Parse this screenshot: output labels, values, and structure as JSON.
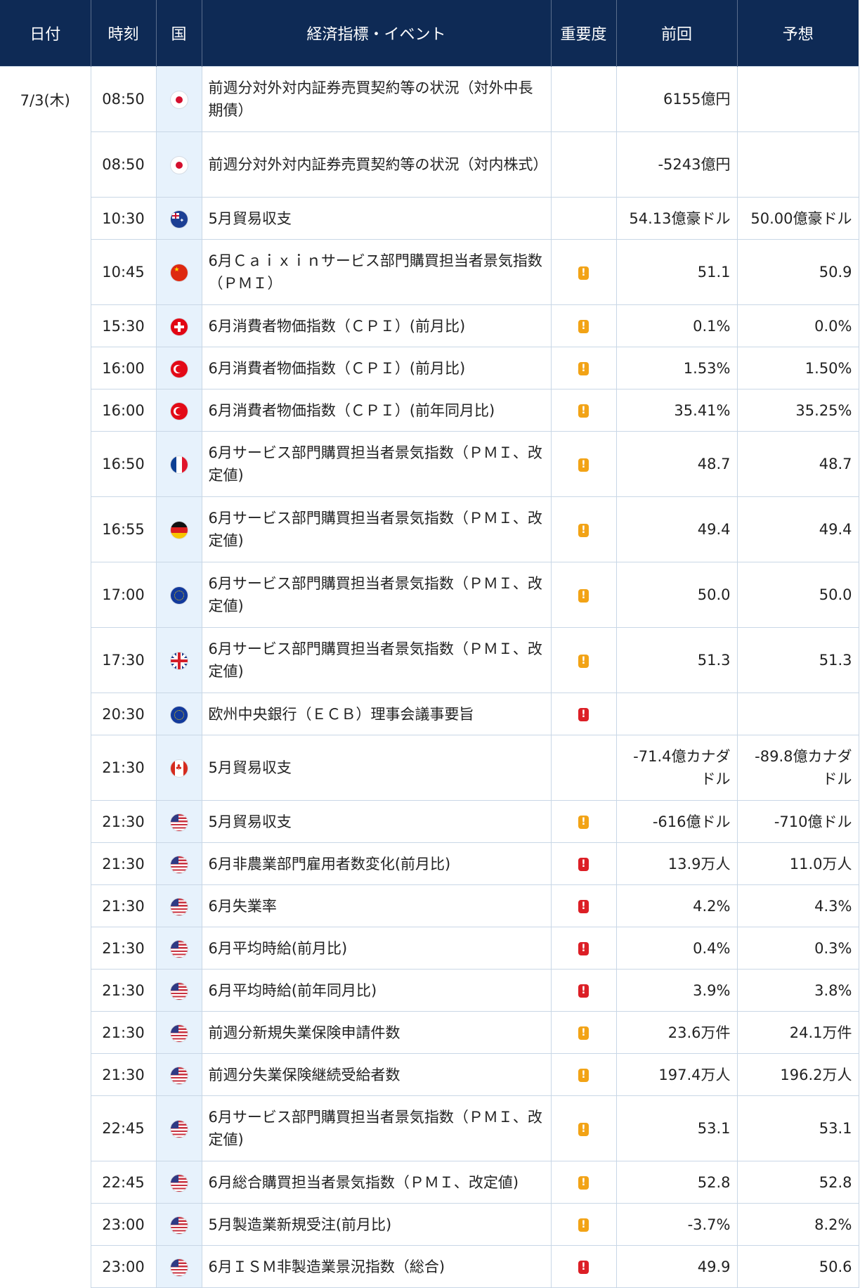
{
  "headers": {
    "date": "日付",
    "time": "時刻",
    "country": "国",
    "event": "経済指標・イベント",
    "importance": "重要度",
    "previous": "前回",
    "forecast": "予想"
  },
  "date": "7/3(木)",
  "rows": [
    {
      "time": "08:50",
      "flag": "jp-flag-icon",
      "event": "前週分対外対内証券売買契約等の状況（対外中長期債）",
      "importance": "",
      "previous": "6155億円",
      "forecast": ""
    },
    {
      "time": "08:50",
      "flag": "jp-flag-icon",
      "event": "前週分対外対内証券売買契約等の状況（対内株式）",
      "importance": "",
      "previous": "-5243億円",
      "forecast": ""
    },
    {
      "time": "10:30",
      "flag": "au-flag-icon",
      "event": "5月貿易収支",
      "importance": "",
      "previous": "54.13億豪ドル",
      "forecast": "50.00億豪ドル"
    },
    {
      "time": "10:45",
      "flag": "cn-flag-icon",
      "event": "6月Ｃａｉｘｉｎサービス部門購買担当者景気指数（ＰＭＩ）",
      "importance": "!",
      "previous": "51.1",
      "forecast": "50.9"
    },
    {
      "time": "15:30",
      "flag": "ch-flag-icon",
      "event": "6月消費者物価指数（ＣＰＩ）(前月比)",
      "importance": "!",
      "previous": "0.1%",
      "forecast": "0.0%"
    },
    {
      "time": "16:00",
      "flag": "tr-flag-icon",
      "event": "6月消費者物価指数（ＣＰＩ）(前月比)",
      "importance": "!",
      "previous": "1.53%",
      "forecast": "1.50%"
    },
    {
      "time": "16:00",
      "flag": "tr-flag-icon",
      "event": "6月消費者物価指数（ＣＰＩ）(前年同月比)",
      "importance": "!",
      "previous": "35.41%",
      "forecast": "35.25%"
    },
    {
      "time": "16:50",
      "flag": "fr-flag-icon",
      "event": "6月サービス部門購買担当者景気指数（ＰＭＩ、改定値)",
      "importance": "!",
      "previous": "48.7",
      "forecast": "48.7"
    },
    {
      "time": "16:55",
      "flag": "de-flag-icon",
      "event": "6月サービス部門購買担当者景気指数（ＰＭＩ、改定値)",
      "importance": "!",
      "previous": "49.4",
      "forecast": "49.4"
    },
    {
      "time": "17:00",
      "flag": "eu-flag-icon",
      "event": "6月サービス部門購買担当者景気指数（ＰＭＩ、改定値)",
      "importance": "!",
      "previous": "50.0",
      "forecast": "50.0"
    },
    {
      "time": "17:30",
      "flag": "gb-flag-icon",
      "event": "6月サービス部門購買担当者景気指数（ＰＭＩ、改定値)",
      "importance": "!",
      "previous": "51.3",
      "forecast": "51.3"
    },
    {
      "time": "20:30",
      "flag": "eu-flag-icon",
      "event": "欧州中央銀行（ＥＣＢ）理事会議事要旨",
      "importance": "!",
      "previous": "",
      "forecast": ""
    },
    {
      "time": "21:30",
      "flag": "ca-flag-icon",
      "event": "5月貿易収支",
      "importance": "",
      "previous": "-71.4億カナダドル",
      "forecast": "-89.8億カナダドル"
    },
    {
      "time": "21:30",
      "flag": "us-flag-icon",
      "event": "5月貿易収支",
      "importance": "!",
      "previous": "-616億ドル",
      "forecast": "-710億ドル"
    },
    {
      "time": "21:30",
      "flag": "us-flag-icon",
      "event": "6月非農業部門雇用者数変化(前月比)",
      "importance": "!",
      "previous": "13.9万人",
      "forecast": "11.0万人"
    },
    {
      "time": "21:30",
      "flag": "us-flag-icon",
      "event": "6月失業率",
      "importance": "!",
      "previous": "4.2%",
      "forecast": "4.3%"
    },
    {
      "time": "21:30",
      "flag": "us-flag-icon",
      "event": "6月平均時給(前月比)",
      "importance": "!",
      "previous": "0.4%",
      "forecast": "0.3%"
    },
    {
      "time": "21:30",
      "flag": "us-flag-icon",
      "event": "6月平均時給(前年同月比)",
      "importance": "!",
      "previous": "3.9%",
      "forecast": "3.8%"
    },
    {
      "time": "21:30",
      "flag": "us-flag-icon",
      "event": "前週分新規失業保険申請件数",
      "importance": "!",
      "previous": "23.6万件",
      "forecast": "24.1万件"
    },
    {
      "time": "21:30",
      "flag": "us-flag-icon",
      "event": "前週分失業保険継続受給者数",
      "importance": "!",
      "previous": "197.4万人",
      "forecast": "196.2万人"
    },
    {
      "time": "22:45",
      "flag": "us-flag-icon",
      "event": "6月サービス部門購買担当者景気指数（ＰＭＩ、改定値)",
      "importance": "!",
      "previous": "53.1",
      "forecast": "53.1"
    },
    {
      "time": "22:45",
      "flag": "us-flag-icon",
      "event": "6月総合購買担当者景気指数（ＰＭＩ、改定値)",
      "importance": "!",
      "previous": "52.8",
      "forecast": "52.8"
    },
    {
      "time": "23:00",
      "flag": "us-flag-icon",
      "event": "5月製造業新規受注(前月比)",
      "importance": "!",
      "previous": "-3.7%",
      "forecast": "8.2%"
    },
    {
      "time": "23:00",
      "flag": "us-flag-icon",
      "event": "6月ＩＳＭ非製造業景況指数（総合)",
      "importance": "!",
      "previous": "49.9",
      "forecast": "50.6"
    }
  ],
  "importance_levels": [
    "",
    "",
    "",
    "medium",
    "medium",
    "medium",
    "medium",
    "medium",
    "medium",
    "medium",
    "medium",
    "high",
    "",
    "medium",
    "high",
    "high",
    "high",
    "high",
    "medium",
    "medium",
    "medium",
    "medium",
    "medium",
    "high"
  ],
  "colors": {
    "header_bg": "#0e2a55",
    "importance_medium": "#f2a316",
    "importance_high": "#dc1f26",
    "country_col_bg": "#e7f2fc"
  }
}
